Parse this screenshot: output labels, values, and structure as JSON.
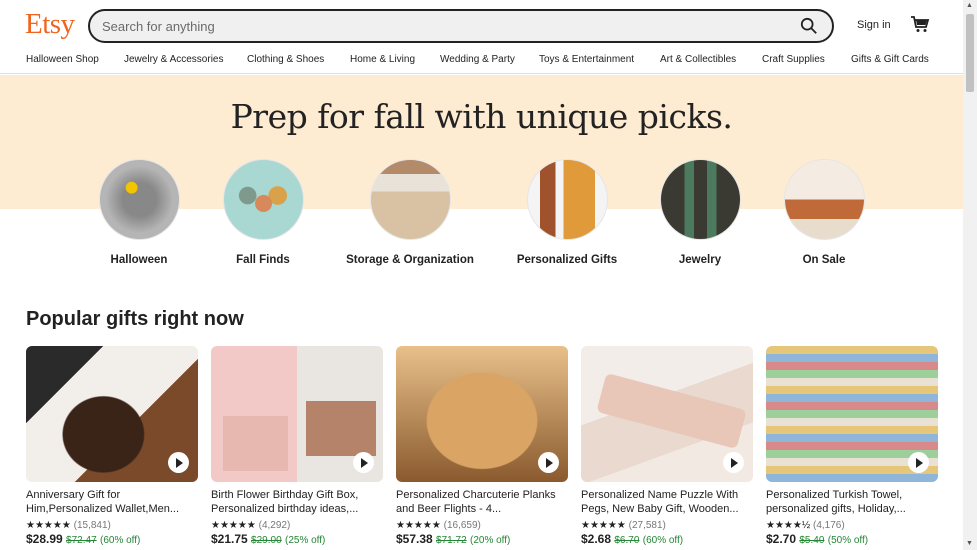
{
  "header": {
    "logo": "Etsy",
    "search_placeholder": "Search for anything",
    "sign_in": "Sign in",
    "brand_color": "#f1641e"
  },
  "nav": [
    "Halloween Shop",
    "Jewelry & Accessories",
    "Clothing & Shoes",
    "Home & Living",
    "Wedding & Party",
    "Toys & Entertainment",
    "Art & Collectibles",
    "Craft Supplies",
    "Gifts & Gift Cards"
  ],
  "hero": {
    "title": "Prep for fall with unique picks.",
    "background": "#fdebd2",
    "categories": [
      {
        "label": "Halloween"
      },
      {
        "label": "Fall Finds"
      },
      {
        "label": "Storage & Organization"
      },
      {
        "label": "Personalized Gifts"
      },
      {
        "label": "Jewelry"
      },
      {
        "label": "On Sale"
      }
    ]
  },
  "popular": {
    "title": "Popular gifts right now",
    "items": [
      {
        "title": "Anniversary Gift for Him,Personalized Wallet,Men...",
        "stars": "★★★★★",
        "rating": 5,
        "count": "(15,841)",
        "price": "$28.99",
        "original": "$72.47",
        "discount": "(60% off)"
      },
      {
        "title": "Birth Flower Birthday Gift Box, Personalized birthday ideas,...",
        "stars": "★★★★★",
        "rating": 5,
        "count": "(4,292)",
        "price": "$21.75",
        "original": "$29.00",
        "discount": "(25% off)"
      },
      {
        "title": "Personalized Charcuterie Planks and Beer Flights - 4...",
        "stars": "★★★★★",
        "rating": 5,
        "count": "(16,659)",
        "price": "$57.38",
        "original": "$71.72",
        "discount": "(20% off)"
      },
      {
        "title": "Personalized Name Puzzle With Pegs, New Baby Gift, Wooden...",
        "stars": "★★★★★",
        "rating": 5,
        "count": "(27,581)",
        "price": "$2.68",
        "original": "$6.70",
        "discount": "(60% off)"
      },
      {
        "title": "Personalized Turkish Towel, personalized gifts, Holiday,...",
        "stars": "★★★★½",
        "rating": 4.5,
        "count": "(4,176)",
        "price": "$2.70",
        "original": "$5.40",
        "discount": "(50% off)"
      }
    ]
  }
}
